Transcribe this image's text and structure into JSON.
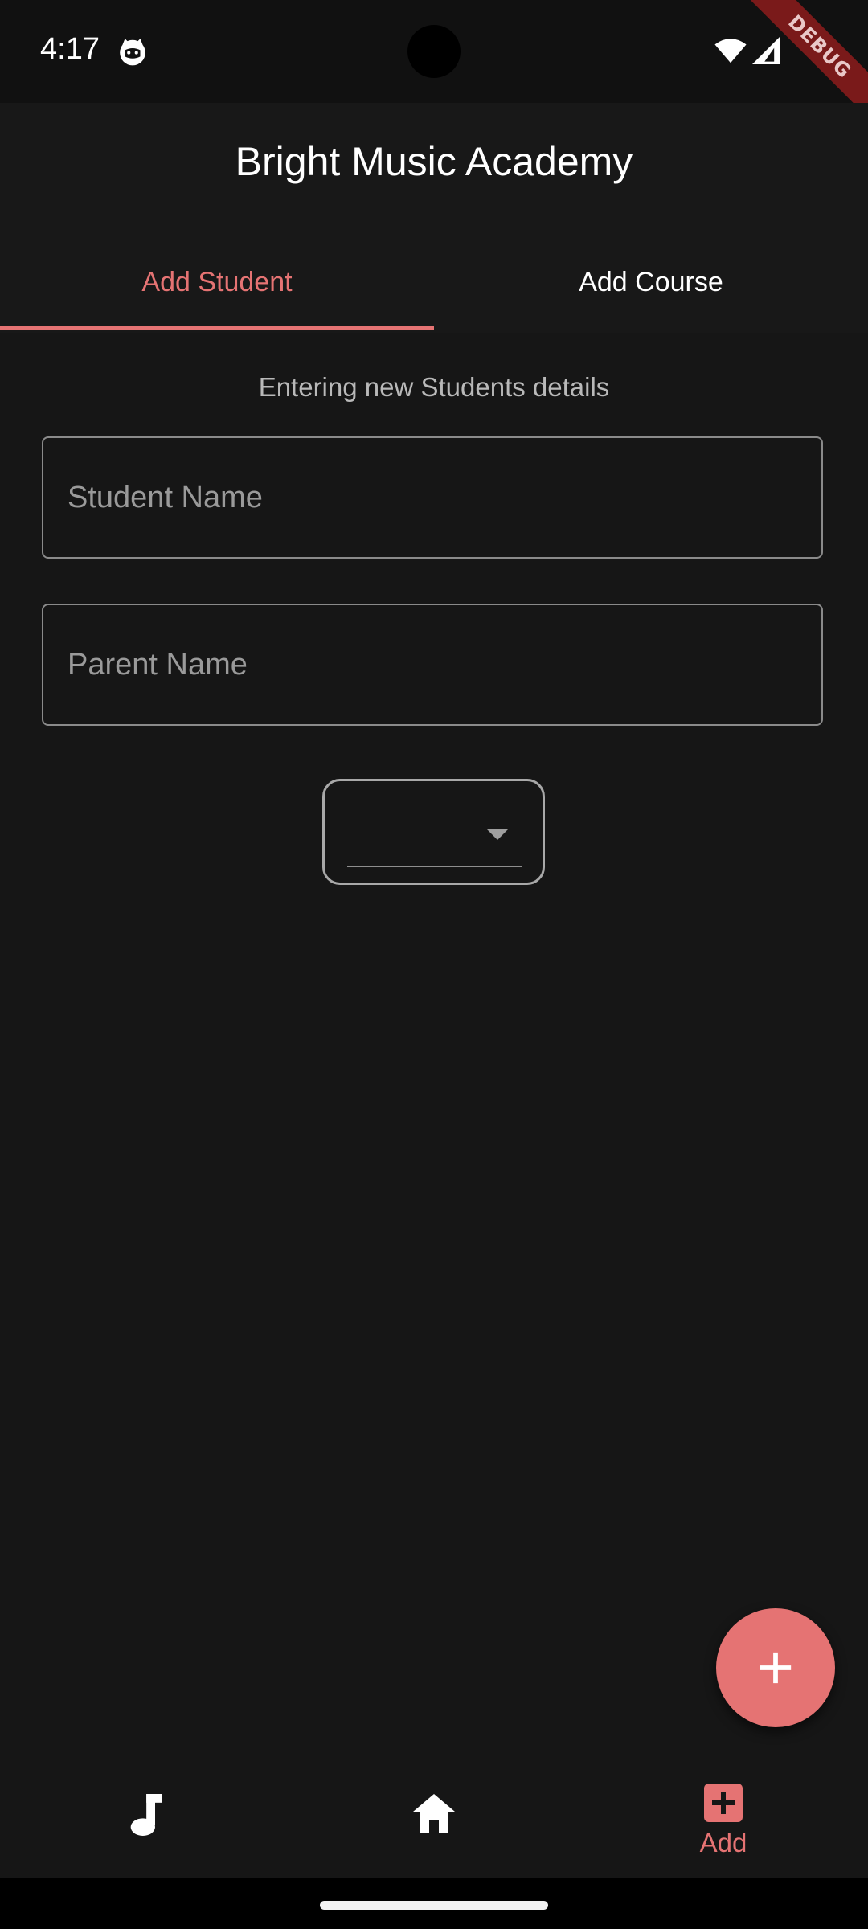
{
  "status_bar": {
    "time": "4:17",
    "debug_banner": "DEBUG",
    "icons": [
      "cat-notification-icon",
      "wifi-icon",
      "cellular-signal-icon"
    ]
  },
  "app_bar": {
    "title": "Bright Music Academy",
    "tabs": [
      {
        "label": "Add Student",
        "selected": true
      },
      {
        "label": "Add Course",
        "selected": false
      }
    ]
  },
  "form": {
    "subtitle": "Entering new Students details",
    "student_name": {
      "value": "",
      "placeholder": "Student Name"
    },
    "parent_name": {
      "value": "",
      "placeholder": "Parent Name"
    },
    "course_dropdown": {
      "selected": "",
      "icon": "arrow-drop-down-icon"
    }
  },
  "fab": {
    "icon": "plus-icon"
  },
  "bottom_nav": {
    "items": [
      {
        "icon": "music-note-icon",
        "label": "",
        "selected": false
      },
      {
        "icon": "home-icon",
        "label": "",
        "selected": false
      },
      {
        "icon": "add-box-icon",
        "label": "Add",
        "selected": true
      }
    ]
  },
  "colors": {
    "accent": "#e57373",
    "background": "#161616",
    "status_bar": "#111111",
    "text_primary": "#ffffff",
    "text_secondary": "#b9b9b9",
    "debug_ribbon": "#7a1a1a"
  }
}
